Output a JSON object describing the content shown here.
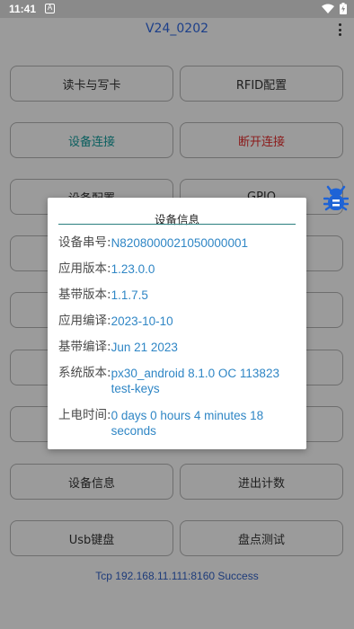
{
  "status_bar": {
    "time": "11:41"
  },
  "app": {
    "title": "V24_0202",
    "buttons": [
      {
        "label": "读卡与写卡"
      },
      {
        "label": "RFID配置"
      },
      {
        "label": "设备连接"
      },
      {
        "label": "断开连接"
      },
      {
        "label": "设备配置"
      },
      {
        "label": "GPIO"
      },
      {
        "label": "设备信息"
      },
      {
        "label": "进出计数"
      },
      {
        "label": "Usb键盘"
      },
      {
        "label": "盘点测试"
      }
    ],
    "tcp_status": "Tcp 192.168.11.111:8160 Success"
  },
  "dialog": {
    "title": "设备信息",
    "rows": [
      {
        "label": "设备串号:",
        "value": "N8208000021050000001"
      },
      {
        "label": "应用版本:",
        "value": "1.23.0.0"
      },
      {
        "label": "基带版本:",
        "value": "1.1.7.5"
      },
      {
        "label": "应用编译:",
        "value": "2023-10-10"
      },
      {
        "label": "基带编译:",
        "value": "Jun 21 2023"
      },
      {
        "label": "系统版本:",
        "value": "px30_android 8.1.0 OC 113823 test-keys"
      },
      {
        "label": "上电时间:",
        "value": "0 days 0 hours 4 minutes 18 seconds"
      }
    ]
  },
  "colors": {
    "dialog_value": "#2f86c5",
    "dialog_divider": "#2a7f7f",
    "connect_text": "#0a5f5f",
    "disconnect_text": "#8b1a1a",
    "bug_icon": "#1e63d6"
  },
  "icons": [
    "notification-icon",
    "wifi-icon",
    "battery-icon",
    "overflow-menu-icon",
    "bug-icon"
  ]
}
